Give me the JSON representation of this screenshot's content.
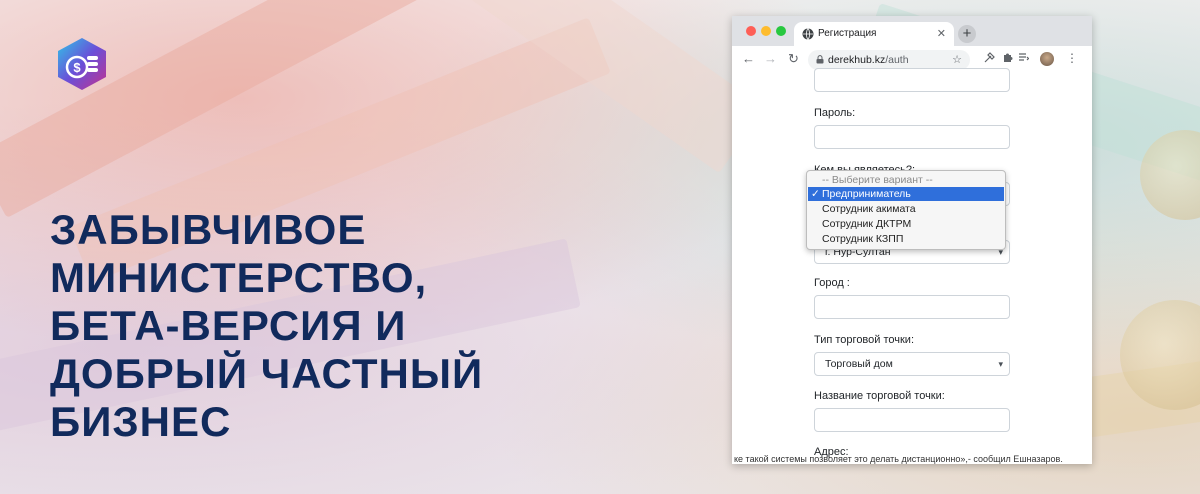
{
  "headline": {
    "lines": [
      "ЗАБЫВЧИВОЕ",
      "МИНИСТЕРСТВО,",
      "БЕТА-ВЕРСИЯ И",
      "ДОБРЫЙ ЧАСТНЫЙ",
      "БИЗНЕС"
    ]
  },
  "colors": {
    "headline": "#112a5c",
    "accent_selected": "#2f6fdb"
  },
  "logo": {
    "icon": "coins-dollar-logo"
  },
  "browser": {
    "tab_title": "Регистрация",
    "tab_close": "✕",
    "new_tab": "+",
    "url_host": "derekhub.kz",
    "url_path": "/auth",
    "back": "←",
    "forward": "→",
    "reload": "↻",
    "bookmark": "☆",
    "menu": "⋮"
  },
  "form": {
    "password_label": "Пароль:",
    "role_label": "Кем вы являетесь?:",
    "role_dropdown": {
      "options": [
        {
          "label": "-- Выберите вариант --",
          "placeholder": true
        },
        {
          "label": "Предприниматель",
          "selected": true
        },
        {
          "label": "Сотрудник акимата"
        },
        {
          "label": "Сотрудник ДКТРМ"
        },
        {
          "label": "Сотрудник КЗПП"
        }
      ],
      "check_mark": "✓"
    },
    "region_value": "г. Нур-Султан",
    "city_label": "Город :",
    "point_type_label": "Тип торговой точки:",
    "point_type_value": "Торговый дом",
    "point_name_label": "Название торговой точки:",
    "address_label": "Адрес:"
  },
  "background_text": {
    "bottom_line": "ке такой системы позволяет это делать дистанционно»,- сообщил Ешназаров."
  }
}
